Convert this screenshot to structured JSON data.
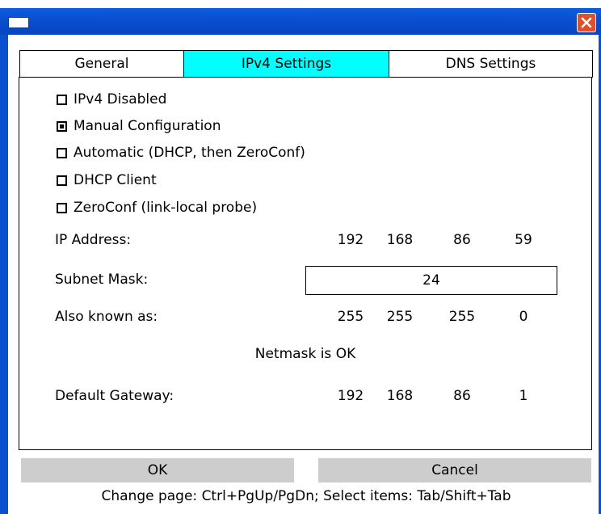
{
  "window": {
    "close_glyph": "close-icon",
    "accent_color": "#0a4fd0"
  },
  "tabs": [
    {
      "label": "General",
      "active": false
    },
    {
      "label": "IPv4 Settings",
      "active": true
    },
    {
      "label": "DNS Settings",
      "active": false
    }
  ],
  "options": [
    {
      "label": "IPv4 Disabled",
      "checked": false
    },
    {
      "label": "Manual Configuration",
      "checked": true
    },
    {
      "label": "Automatic (DHCP, then ZeroConf)",
      "checked": false
    },
    {
      "label": "DHCP Client",
      "checked": false
    },
    {
      "label": "ZeroConf (link-local probe)",
      "checked": false
    }
  ],
  "fields": {
    "ip_address": {
      "label": "IP Address:",
      "octets": [
        "192",
        "168",
        "86",
        "59"
      ]
    },
    "subnet_mask": {
      "label": "Subnet Mask:",
      "value": "24"
    },
    "also_known_as": {
      "label": "Also known as:",
      "octets": [
        "255",
        "255",
        "255",
        "0"
      ]
    },
    "netmask_status": "Netmask is OK",
    "default_gateway": {
      "label": "Default Gateway:",
      "octets": [
        "192",
        "168",
        "86",
        "1"
      ]
    }
  },
  "buttons": {
    "ok": "OK",
    "cancel": "Cancel"
  },
  "hint": "Change page: Ctrl+PgUp/PgDn; Select items: Tab/Shift+Tab"
}
